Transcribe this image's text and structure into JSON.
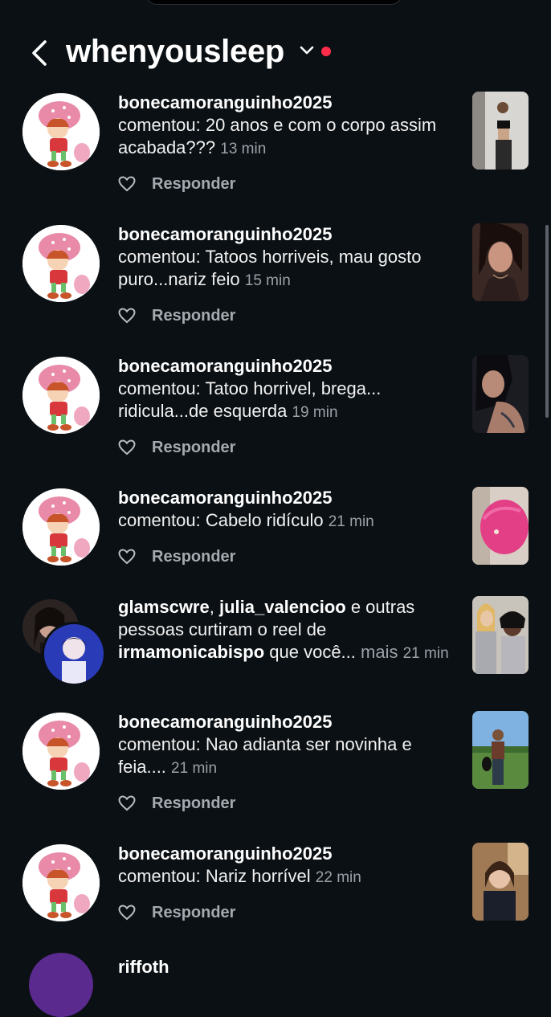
{
  "header": {
    "account_name": "whenyousleep"
  },
  "notifications": [
    {
      "username": "bonecamoranguinho2025",
      "message": "comentou: 20 anos e com o corpo assim acabada???",
      "time": "13 min",
      "reply_label": "Responder"
    },
    {
      "username": "bonecamoranguinho2025",
      "message": "comentou: Tatoos horriveis, mau gosto puro...nariz feio",
      "time": "15 min",
      "reply_label": "Responder"
    },
    {
      "username": "bonecamoranguinho2025",
      "message": "comentou: Tatoo horrivel, brega... ridicula...de esquerda",
      "time": "19 min",
      "reply_label": "Responder"
    },
    {
      "username": "bonecamoranguinho2025",
      "message": "comentou: Cabelo ridículo",
      "time": "21 min",
      "reply_label": "Responder"
    },
    {
      "user1": "glamscwre",
      "sep": ", ",
      "user2": "julia_valencioo",
      "mid": " e outras pessoas curtiram o reel de ",
      "user3": "irmamonicabispo",
      "tail": " que você...",
      "more": "mais",
      "time": "21 min"
    },
    {
      "username": "bonecamoranguinho2025",
      "message": "comentou: Nao adianta ser novinha e feia....",
      "time": "21 min",
      "reply_label": "Responder"
    },
    {
      "username": "bonecamoranguinho2025",
      "message": "comentou: Nariz horrível",
      "time": "22 min",
      "reply_label": "Responder"
    }
  ],
  "partial_next_username": "riffoth",
  "colors": {
    "background": "#0b1014",
    "notification_dot": "#ff2d4a",
    "secondary_text": "#9aa1a8"
  }
}
